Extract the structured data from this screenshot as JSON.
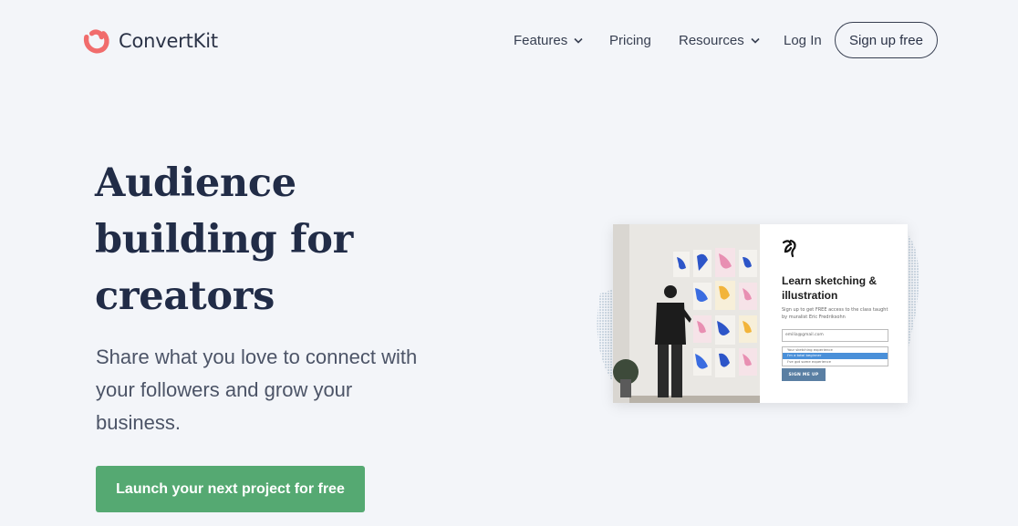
{
  "brand": {
    "name": "ConvertKit",
    "logo_icon": "convertkit-logo-icon",
    "accent": "#f16c6c"
  },
  "nav": {
    "features": "Features",
    "pricing": "Pricing",
    "resources": "Resources",
    "login": "Log In",
    "signup": "Sign up free"
  },
  "hero": {
    "title": "Audience building for creators",
    "subtitle": "Share what you love to connect with your followers and grow your business.",
    "cta": "Launch your next project for free",
    "cta_color": "#55a972"
  },
  "preview": {
    "title": "Learn sketching & illustration",
    "description": "Sign up to get FREE access to the class taught by muralist Eric Fredriksohn",
    "email_value": "emilia@gmail.com",
    "select_options": [
      "Your sketching experience",
      "I'm a total beginner",
      "I've got some experience"
    ],
    "button": "SIGN ME UP"
  }
}
